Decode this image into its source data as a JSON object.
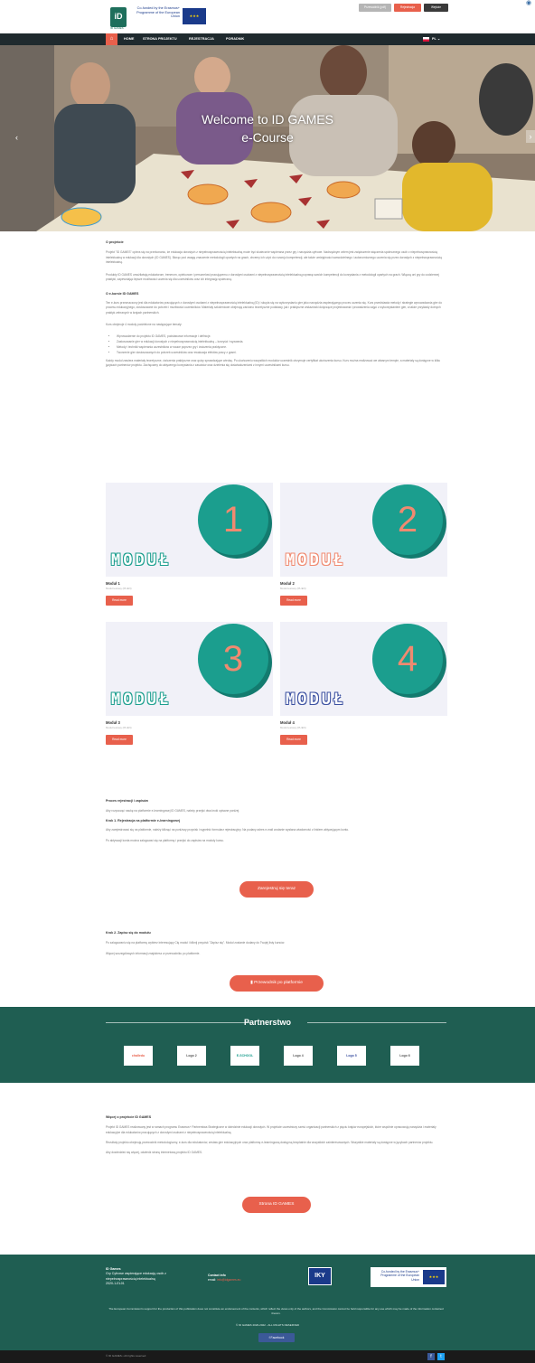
{
  "header": {
    "logo_text": "ID GAMES",
    "eu_text": "Co-funded by the Erasmus+ Programme of the European Union",
    "eu_sub": "2020-1-EL01-KA204-079011",
    "btn_gray": "Przewodnik (pdf)",
    "btn_red": "Rejestracja",
    "btn_dark": "Wejście"
  },
  "nav": {
    "items": [
      "HOME",
      "STRONA PROJEKTU",
      "REJESTRACJA",
      "PORADNIK"
    ],
    "lang": "PL"
  },
  "hero": {
    "title_line1": "Welcome to ID GAMES",
    "title_line2": "e-Course"
  },
  "about": {
    "heading": "O projekcie",
    "para1": "Projekt \"ID GAMES\" opiera się na przekonaniu, że edukacja dorosłych z niepełnosprawnością intelektualną może być skutecznie wspierana przez gry i narzędzia cyfrowe. Nadrzędnym celem jest zwiększenie włączenia społecznego osób z niepełnosprawnością intelektualną w edukacji dla dorosłych (ID GAMES). Biorąc pod uwagę znaczenie metodologii opartych na grach, chcemy ich użyć do rozwoju kompetencji, ale także umiejętności samodzielnego i autonomicznego uczenia się przez dorosłych z niepełnosprawnością intelektualną.",
    "para2": "Produkty ID GAMES umożliwiają edukatorom, trenerom, opiekunom i personelowi pracującemu z dorosłymi osobami z niepełnosprawnością intelektualną poprawę swoich kompetencji do korzystania z metodologii opartych na grach. Włączą oni gry do codziennej praktyki, zapewniając lepsze możliwości uczenia się dla uczestników oraz ich integrację społeczną."
  },
  "course": {
    "heading": "O e-kursie ID GAMES",
    "para1": "Ten e-kurs przeznaczony jest dla edukatorów pracujących z dorosłymi osobami z niepełnosprawnością intelektualną (ID) i skupia się na wykorzystaniu gier jako narzędzia wspierającego proces uczenia się. Kurs przedstawia metody i strategie wprowadzania gier do procesu edukacyjnego, dostosowane do potrzeb i możliwości uczestników. Materiały szkoleniowe obejmują zarówno teoretyczne podstawy, jak i praktyczne wskazówki dotyczące projektowania i prowadzenia zajęć z wykorzystaniem gier, a także przykłady dobrych praktyk zebranych w krajach partnerskich.",
    "list_intro": "Kurs obejmuje 4 moduły podzielone na następujące tematy:",
    "bullets": [
      "Wprowadzenie do projektu ID GAMES, podstawowe informacje i definicje.",
      "Zastosowanie gier w edukacji dorosłych z niepełnosprawnością intelektualną – korzyści i wyzwania.",
      "Metody i techniki wspierania uczestników w nauce poprzez gry i ćwiczenia praktyczne.",
      "Tworzenie gier dostosowanych do potrzeb uczestników oraz ewaluacja efektów pracy z grami."
    ],
    "para2": "Każdy moduł zawiera materiały teoretyczne, ćwiczenia praktyczne oraz quizy sprawdzające wiedzę. Po ukończeniu wszystkich modułów uczestnik otrzymuje certyfikat ukończenia kursu. Kurs można realizować we własnym tempie, a materiały są dostępne w kilku językach partnerów projektu. Zachęcamy do aktywnego korzystania z zasobów oraz dzielenia się doświadczeniami z innymi uczestnikami kursu."
  },
  "modules": [
    {
      "number": "1",
      "word": "MODUŁ",
      "title": "Moduł 1",
      "sub": "Moduł testowy (PL/EN)",
      "button": "Read more"
    },
    {
      "number": "2",
      "word": "MODUŁ",
      "title": "Moduł 2",
      "sub": "Moduł testowy (PL/EN)",
      "button": "Read more"
    },
    {
      "number": "3",
      "word": "MODUŁ",
      "title": "Moduł 3",
      "sub": "Moduł testowy (PL/EN)",
      "button": "Read more"
    },
    {
      "number": "4",
      "word": "MODUŁ",
      "title": "Moduł 4",
      "sub": "Moduł testowy (PL/EN)",
      "button": "Read more"
    }
  ],
  "registration": {
    "heading": "Proces rejestracji i zapisów",
    "intro": "Aby rozpocząć naukę na platformie e-learningowej ID GAMES, należy przejść dwa kroki opisane poniżej.",
    "step1_heading": "Krok 1. Rejestracja na platformie e-learningowej",
    "step1_para1": "Aby zarejestrować się na platformie, należy kliknąć na poniższy przycisk i wypełnić formularz rejestracyjny. Na podany adres e-mail zostanie wysłana wiadomość z linkiem aktywującym konto.",
    "step1_para2": "Po aktywacji konta można zalogować się na platformę i przejść do zapisów na moduły kursu.",
    "step1_button": "Zarejestruj się teraz",
    "step2_heading": "Krok 2. Zapisz się do modułu",
    "step2_para1": "Po zalogowaniu się na platformę wybierz interesujący Cię moduł i kliknij przycisk \"Zapisz się\". Moduł zostanie dodany do Twojej listy kursów.",
    "step2_para2": "Więcej szczegółowych informacji znajdziesz w przewodniku po platformie.",
    "step2_button": "Przewodnik po platformie"
  },
  "partners": {
    "title": "Partnerstwo",
    "logos": [
      "challedu",
      "Logo 2",
      "E-SCHOOL",
      "Logo 4",
      "Logo 5",
      "Logo 6"
    ]
  },
  "more": {
    "heading": "Więcej o projekcie ID GAMES",
    "para1": "Projekt ID GAMES realizowany jest w ramach programu Erasmus+ Partnerstwa Strategiczne w dziedzinie edukacji dorosłych. W projekcie uczestniczy sześć organizacji partnerskich z pięciu krajów europejskich, które wspólnie opracowują narzędzia i materiały edukacyjne dla edukatorów pracujących z dorosłymi osobami z niepełnosprawnością intelektualną.",
    "para2": "Rezultaty projektu obejmują przewodnik metodologiczny, e-kurs dla edukatorów, zestaw gier edukacyjnych oraz platformę e-learningową dostępną bezpłatnie dla wszystkich zainteresowanych. Wszystkie materiały są dostępne w językach partnerów projektu.",
    "para3": "Aby dowiedzieć się więcej, odwiedź stronę internetową projektu ID GAMES.",
    "button": "Strona ID GAMES"
  },
  "footer": {
    "col1_title": "ID Games",
    "col1_text": "Gry Cyfrowe wspierające edukację osób z niepełnosprawnością intelektualną",
    "col1_sub": "2020-1-EL01",
    "col2_title": "Contact info",
    "col2_label": "email:",
    "col2_email": "info@idgames.eu",
    "iky": "IKY",
    "eu_text": "Co-funded by the Erasmus+ Programme of the European Union",
    "disclaimer": "The European Commission's support for the production of this publication does not constitute an endorsement of the contents, which reflect the views only of the authors, and the Commission cannot be held responsible for any use which may be made of the information contained therein.",
    "copyright": "© ID GAMES 2020-2022 - ALL RIGHTS RESERVED",
    "facebook": "Facebook",
    "bottom_text": "© ID GAMES • All rights reserved"
  }
}
